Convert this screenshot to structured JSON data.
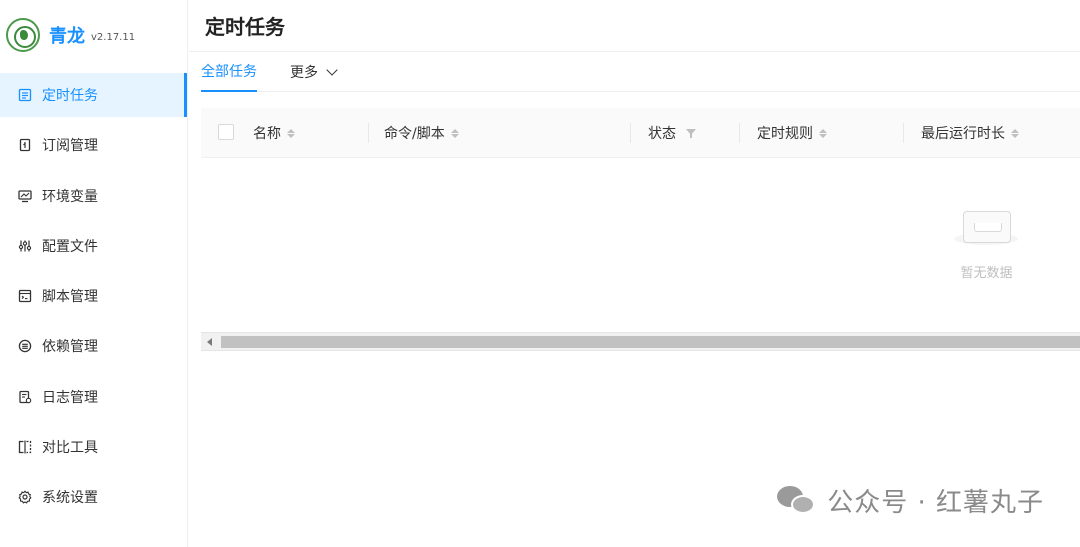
{
  "app": {
    "name": "青龙",
    "version": "v2.17.11"
  },
  "sidebar": {
    "items": [
      {
        "label": "定时任务",
        "icon": "calendar-list-icon",
        "active": true
      },
      {
        "label": "订阅管理",
        "icon": "subscription-icon",
        "active": false
      },
      {
        "label": "环境变量",
        "icon": "monitor-icon",
        "active": false
      },
      {
        "label": "配置文件",
        "icon": "sliders-icon",
        "active": false
      },
      {
        "label": "脚本管理",
        "icon": "code-file-icon",
        "active": false
      },
      {
        "label": "依赖管理",
        "icon": "stack-icon",
        "active": false
      },
      {
        "label": "日志管理",
        "icon": "log-icon",
        "active": false
      },
      {
        "label": "对比工具",
        "icon": "diff-icon",
        "active": false
      },
      {
        "label": "系统设置",
        "icon": "gear-icon",
        "active": false
      }
    ]
  },
  "header": {
    "title": "定时任务"
  },
  "tabs": [
    {
      "label": "全部任务",
      "active": true
    },
    {
      "label": "更多",
      "active": false
    }
  ],
  "table": {
    "columns": [
      {
        "label": "名称",
        "control": "sort"
      },
      {
        "label": "命令/脚本",
        "control": "sort"
      },
      {
        "label": "状态",
        "control": "filter"
      },
      {
        "label": "定时规则",
        "control": "sort"
      },
      {
        "label": "最后运行时长",
        "control": "sort"
      }
    ],
    "rows": [],
    "empty_text": "暂无数据"
  },
  "watermark": {
    "text": "公众号 · 红薯丸子"
  },
  "colors": {
    "accent": "#1890ff",
    "active_bg": "#e6f4ff",
    "header_bg": "#fafafa"
  }
}
